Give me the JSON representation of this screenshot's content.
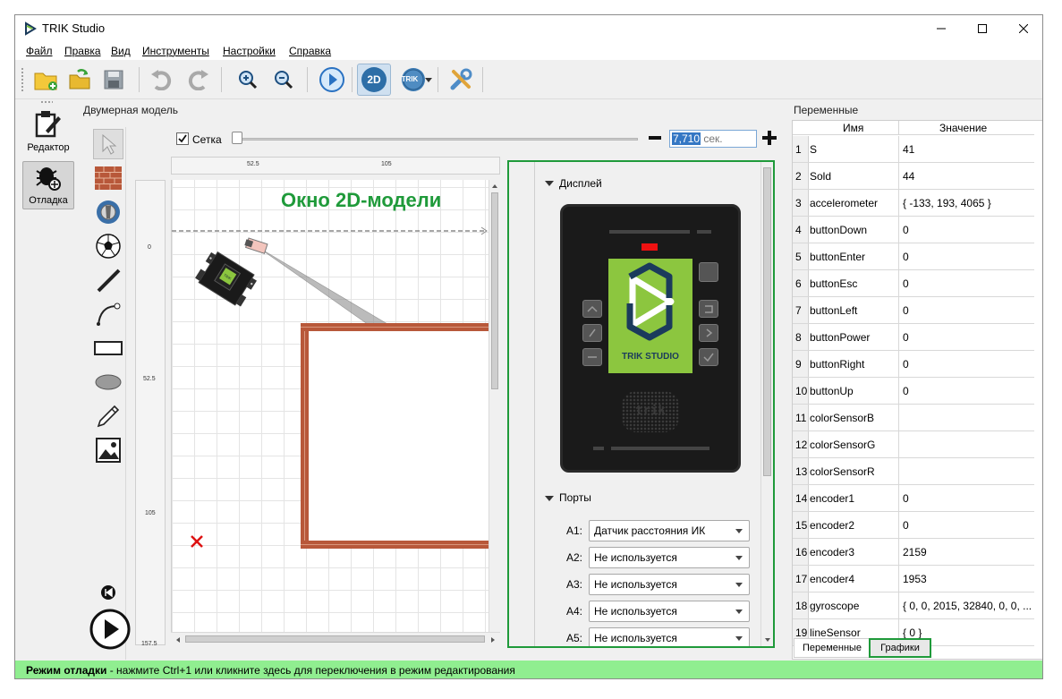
{
  "window": {
    "title": "TRIK Studio"
  },
  "menu": [
    "Файл",
    "Правка",
    "Вид",
    "Инструменты",
    "Настройки",
    "Справка"
  ],
  "toolbar": {
    "icons": [
      "new-project-icon",
      "open-project-icon",
      "save-icon",
      "undo-icon",
      "redo-icon",
      "zoom-in-icon",
      "zoom-out-icon",
      "run-icon",
      "2d-mode-icon",
      "trik-robot-icon",
      "settings-tools-icon"
    ],
    "btn_2d": "2D",
    "btn_trik": "TRIK"
  },
  "modes": [
    {
      "label": "Редактор",
      "icon": "editor-icon"
    },
    {
      "label": "Отладка",
      "icon": "debug-bug-icon"
    }
  ],
  "scene": {
    "title": "Двумерная модель",
    "grid_label": "Сетка",
    "grid_checked": true,
    "time_value": "7,710",
    "time_unit": "сек.",
    "ruler_h": [
      "52.5",
      "105"
    ],
    "ruler_v": [
      "0",
      "52.5",
      "105",
      "157.5"
    ],
    "overlay_label": "Окно 2D-модели",
    "robot_label": "TRIK"
  },
  "robot_panel": {
    "display_section": "Дисплей",
    "ports_section": "Порты",
    "screen_label": "TRIK STUDIO",
    "speaker_label": "trik",
    "ports": [
      {
        "port": "A1:",
        "value": "Датчик расстояния ИК"
      },
      {
        "port": "A2:",
        "value": "Не используется"
      },
      {
        "port": "A3:",
        "value": "Не используется"
      },
      {
        "port": "A4:",
        "value": "Не используется"
      },
      {
        "port": "A5:",
        "value": "Не используется"
      }
    ]
  },
  "variables": {
    "title": "Переменные",
    "col_name": "Имя",
    "col_value": "Значение",
    "rows": [
      {
        "n": "1",
        "name": "S",
        "value": "41"
      },
      {
        "n": "2",
        "name": "Sold",
        "value": "44"
      },
      {
        "n": "3",
        "name": "accelerometer",
        "value": "{ -133, 193, 4065 }"
      },
      {
        "n": "4",
        "name": "buttonDown",
        "value": "0"
      },
      {
        "n": "5",
        "name": "buttonEnter",
        "value": "0"
      },
      {
        "n": "6",
        "name": "buttonEsc",
        "value": "0"
      },
      {
        "n": "7",
        "name": "buttonLeft",
        "value": "0"
      },
      {
        "n": "8",
        "name": "buttonPower",
        "value": "0"
      },
      {
        "n": "9",
        "name": "buttonRight",
        "value": "0"
      },
      {
        "n": "10",
        "name": "buttonUp",
        "value": "0"
      },
      {
        "n": "11",
        "name": "colorSensorB",
        "value": ""
      },
      {
        "n": "12",
        "name": "colorSensorG",
        "value": ""
      },
      {
        "n": "13",
        "name": "colorSensorR",
        "value": ""
      },
      {
        "n": "14",
        "name": "encoder1",
        "value": "0"
      },
      {
        "n": "15",
        "name": "encoder2",
        "value": "0"
      },
      {
        "n": "16",
        "name": "encoder3",
        "value": "2159"
      },
      {
        "n": "17",
        "name": "encoder4",
        "value": "1953"
      },
      {
        "n": "18",
        "name": "gyroscope",
        "value": "{ 0, 0, 2015, 32840, 0, 0, ..."
      },
      {
        "n": "19",
        "name": "lineSensor",
        "value": "{ 0 }"
      }
    ],
    "tabs": [
      "Переменные",
      "Графики"
    ]
  },
  "status": {
    "bold": "Режим отладки",
    "text": " - нажмите Ctrl+1 или кликните здесь для переключения в режим редактирования"
  },
  "colors": {
    "highlight_green": "#1f9a3a",
    "status_bg": "#90ee90",
    "screen_green": "#8cc63f",
    "brick": "#b8583a"
  }
}
